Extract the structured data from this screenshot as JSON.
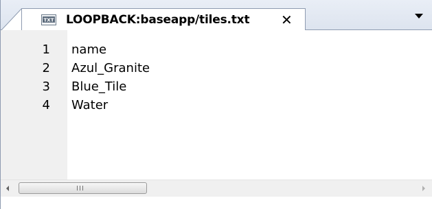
{
  "tab": {
    "icon": "txt-file-icon",
    "title": "LOOPBACK:baseapp/tiles.txt",
    "close_glyph": "✕"
  },
  "tabstrip": {
    "dropdown_icon": "chevron-down-icon"
  },
  "editor": {
    "lines": [
      {
        "number": "1",
        "text": "name"
      },
      {
        "number": "2",
        "text": "Azul_Granite"
      },
      {
        "number": "3",
        "text": "Blue_Tile"
      },
      {
        "number": "4",
        "text": "Water"
      }
    ]
  },
  "scrollbar": {
    "left_icon": "scroll-left-icon",
    "right_icon": "scroll-right-icon"
  },
  "colors": {
    "border": "#8e9bb0",
    "gutter": "#f0f0f0",
    "tabstrip": "#dde4ef"
  }
}
